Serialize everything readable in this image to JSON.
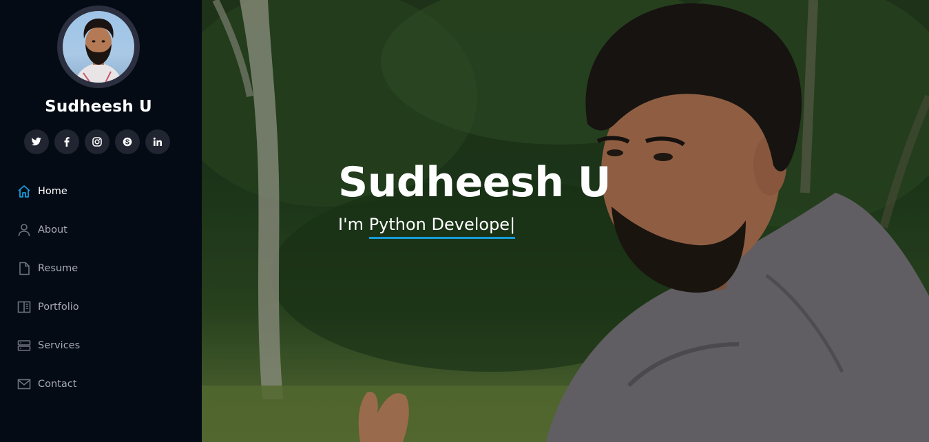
{
  "sidebar": {
    "profile_name": "Sudheesh U",
    "socials": [
      {
        "icon": "twitter-icon"
      },
      {
        "icon": "facebook-icon"
      },
      {
        "icon": "instagram-icon"
      },
      {
        "icon": "skype-icon"
      },
      {
        "icon": "linkedin-icon"
      }
    ],
    "nav": [
      {
        "label": "Home",
        "icon": "home-icon",
        "active": true
      },
      {
        "label": "About",
        "icon": "person-icon"
      },
      {
        "label": "Resume",
        "icon": "file-icon"
      },
      {
        "label": "Portfolio",
        "icon": "book-half-icon"
      },
      {
        "label": "Services",
        "icon": "server-icon"
      },
      {
        "label": "Contact",
        "icon": "envelope-icon"
      }
    ]
  },
  "hero": {
    "title": "Sudheesh U",
    "prefix": "I'm ",
    "typed_text": "Python Develope",
    "cursor": "|"
  },
  "colors": {
    "accent": "#149ddd",
    "sidebar_bg": "#040b14",
    "social_bg": "#212431",
    "nav_text": "#a8a9b4"
  }
}
